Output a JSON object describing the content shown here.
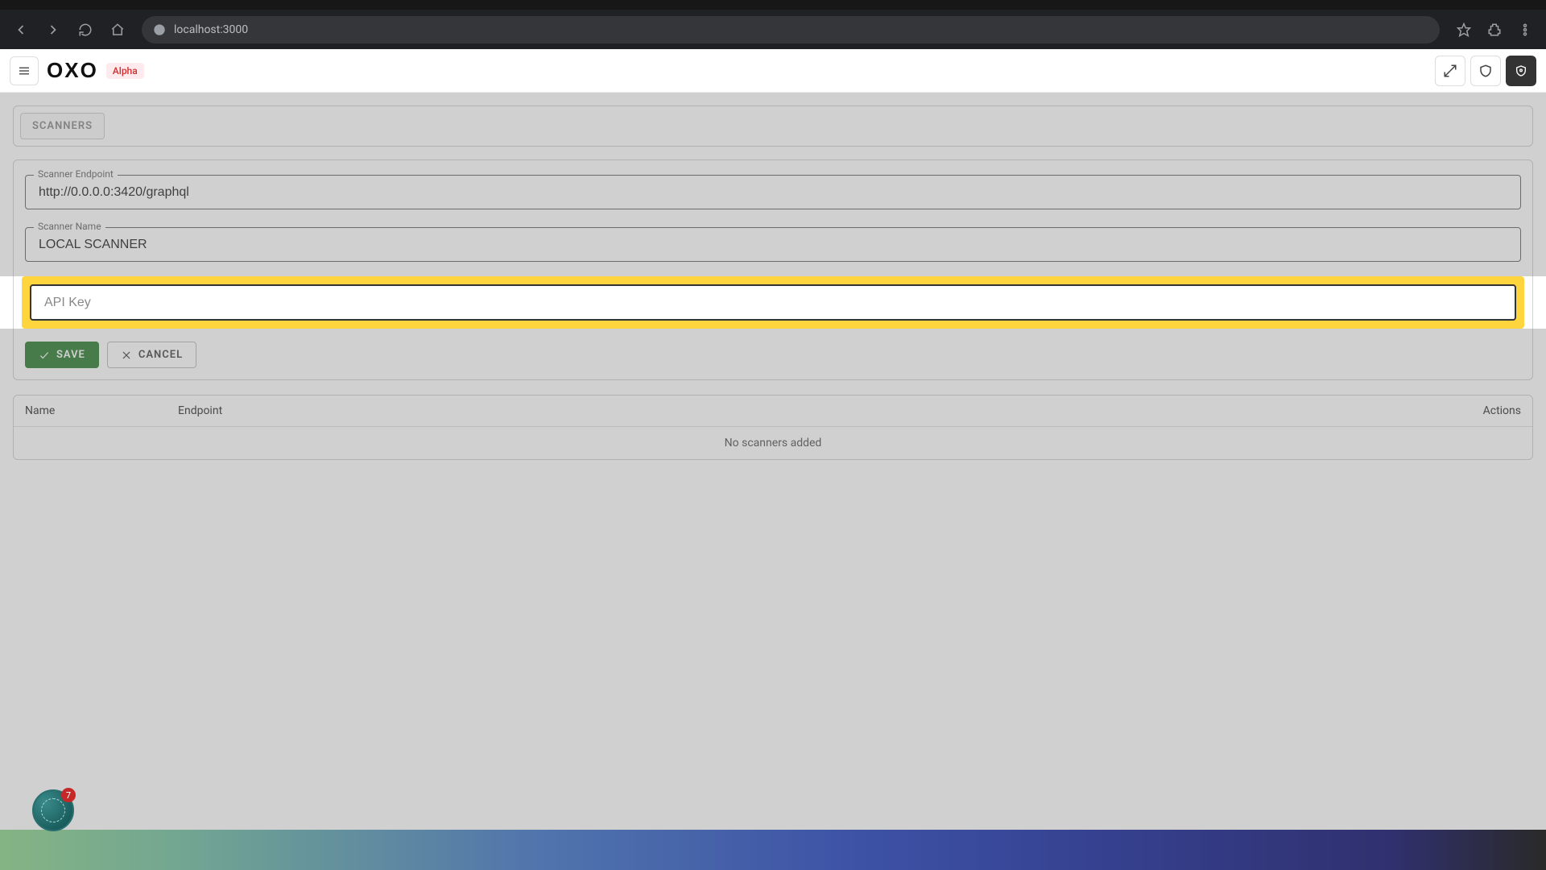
{
  "browser": {
    "url": "localhost:3000"
  },
  "header": {
    "logo": "OXO",
    "badge": "Alpha"
  },
  "tabs": {
    "scanners": "SCANNERS"
  },
  "form": {
    "endpoint_label": "Scanner Endpoint",
    "endpoint_value": "http://0.0.0.0:3420/graphql",
    "name_label": "Scanner Name",
    "name_value": "LOCAL SCANNER",
    "apikey_placeholder": "API Key",
    "save": "SAVE",
    "cancel": "CANCEL"
  },
  "table": {
    "col_name": "Name",
    "col_endpoint": "Endpoint",
    "col_actions": "Actions",
    "empty": "No scanners added"
  },
  "float": {
    "count": "7"
  }
}
